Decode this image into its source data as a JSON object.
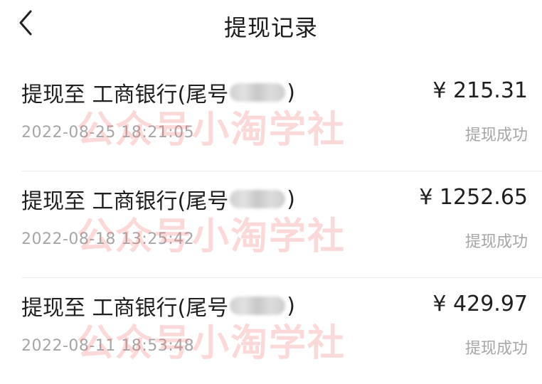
{
  "header": {
    "title": "提现记录",
    "back_icon": "chevron-left-icon"
  },
  "records": [
    {
      "title_prefix": "提现至 工商银行(尾号",
      "title_suffix": ")",
      "amount": "¥ 215.31",
      "time": "2022-08-25 18:21:05",
      "status": "提现成功",
      "watermark": "公众号小淘学社"
    },
    {
      "title_prefix": "提现至 工商银行(尾号",
      "title_suffix": ")",
      "amount": "¥ 1252.65",
      "time": "2022-08-18 13:25:42",
      "status": "提现成功",
      "watermark": "公众号小淘学社"
    },
    {
      "title_prefix": "提现至 工商银行(尾号",
      "title_suffix": ")",
      "amount": "¥ 429.97",
      "time": "2022-08-11 18:53:48",
      "status": "提现成功",
      "watermark": "公众号小淘学社"
    }
  ],
  "colors": {
    "text_primary": "#1f1f1f",
    "text_secondary": "#a6a6a6",
    "watermark": "#ef7676",
    "divider": "#eeeeee"
  }
}
